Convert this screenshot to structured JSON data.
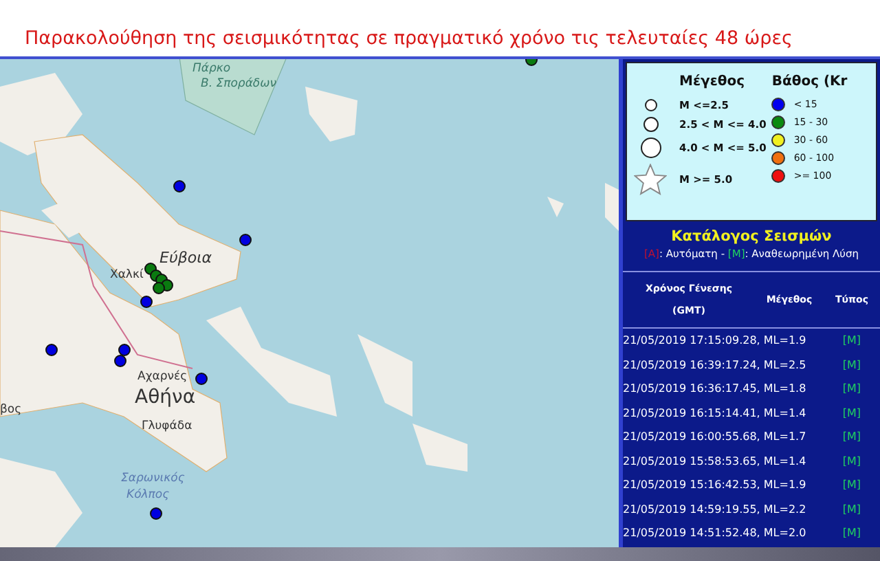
{
  "page_title": "Παρακολούθηση της σεισμικότητας σε πραγματικό χρόνο τις τελευταίες 48 ώρες",
  "map": {
    "labels": [
      {
        "kind": "park",
        "text": "Πάρκο"
      },
      {
        "kind": "park",
        "text": "Β. Σποράδων"
      },
      {
        "kind": "region",
        "text": "Εύβοια"
      },
      {
        "kind": "town",
        "text": "Χαλκί"
      },
      {
        "kind": "town",
        "text": "Αχαρνές"
      },
      {
        "kind": "city",
        "text": "Αθήνα"
      },
      {
        "kind": "town",
        "text": "Γλυφάδα"
      },
      {
        "kind": "sea",
        "text": "Σαρωνικός"
      },
      {
        "kind": "sea",
        "text": "Κόλπος"
      },
      {
        "kind": "town",
        "text": "βος"
      }
    ],
    "quakes": [
      {
        "color": "#0a7a10"
      },
      {
        "color": "#0000e0"
      },
      {
        "color": "#0000e0"
      },
      {
        "color": "#0a7a10"
      },
      {
        "color": "#0a7a10"
      },
      {
        "color": "#0a7a10"
      },
      {
        "color": "#0a7a10"
      },
      {
        "color": "#0a7a10"
      },
      {
        "color": "#0000e0"
      },
      {
        "color": "#0000e0"
      },
      {
        "color": "#0000e0"
      },
      {
        "color": "#0000e0"
      },
      {
        "color": "#0000e0"
      },
      {
        "color": "#0000e0"
      }
    ]
  },
  "legend": {
    "magnitude_title": "Μέγεθος",
    "magnitudes": [
      {
        "kind": "small",
        "label": "M <=2.5"
      },
      {
        "kind": "medium",
        "label": "2.5 < M <= 4.0"
      },
      {
        "kind": "large",
        "label": "4.0 < M <= 5.0"
      },
      {
        "kind": "star",
        "label": "M >= 5.0"
      }
    ],
    "depth_title": "Βάθος (Kr",
    "depths": [
      {
        "color": "#0000ee",
        "label": "< 15"
      },
      {
        "color": "#0a8a10",
        "label": "15 - 30"
      },
      {
        "color": "#f0f020",
        "label": "30 - 60"
      },
      {
        "color": "#f07010",
        "label": "60 - 100"
      },
      {
        "color": "#ee1010",
        "label": ">= 100"
      }
    ]
  },
  "catalog": {
    "title": "Κατάλογος Σεισμών",
    "key": [
      {
        "kind": "tag",
        "text": "[A]",
        "color": "#c01030"
      },
      {
        "kind": "text",
        "text": ": Αυτόματη - "
      },
      {
        "kind": "tag",
        "text": "[M]",
        "color": "#20d060"
      },
      {
        "kind": "text",
        "text": ": Αναθεωρημένη Λύση"
      }
    ],
    "columns": [
      "Χρόνος Γένεσης",
      "(GMT)",
      "Μέγεθος",
      "Τύπος"
    ],
    "rows": [
      {
        "event": "21/05/2019 17:15:09.28, ML=1.9",
        "type": "[M]"
      },
      {
        "event": "21/05/2019 16:39:17.24, ML=2.5",
        "type": "[M]"
      },
      {
        "event": "21/05/2019 16:36:17.45, ML=1.8",
        "type": "[M]"
      },
      {
        "event": "21/05/2019 16:15:14.41, ML=1.4",
        "type": "[M]"
      },
      {
        "event": "21/05/2019 16:00:55.68, ML=1.7",
        "type": "[M]"
      },
      {
        "event": "21/05/2019 15:58:53.65, ML=1.4",
        "type": "[M]"
      },
      {
        "event": "21/05/2019 15:16:42.53, ML=1.9",
        "type": "[M]"
      },
      {
        "event": "21/05/2019 14:59:19.55, ML=2.2",
        "type": "[M]"
      },
      {
        "event": "21/05/2019 14:51:52.48, ML=2.0",
        "type": "[M]"
      }
    ]
  }
}
